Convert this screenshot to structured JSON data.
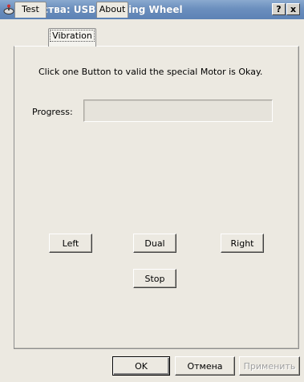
{
  "window": {
    "title": "Свойства: USB Steering Wheel",
    "app_icon": "joystick-icon",
    "help_label": "?",
    "close_label": "x"
  },
  "tabs": [
    {
      "label": "Test",
      "active": false
    },
    {
      "label": "Vibration",
      "active": true
    },
    {
      "label": "About",
      "active": false
    }
  ],
  "vibration": {
    "instruction": "Click one Button to valid the special Motor is Okay.",
    "progress_label": "Progress:",
    "progress_fraction": 0,
    "buttons": {
      "left": "Left",
      "dual": "Dual",
      "right": "Right",
      "stop": "Stop"
    }
  },
  "footer": {
    "ok": "OK",
    "cancel": "Отмена",
    "apply": "Применить",
    "apply_enabled": false
  }
}
